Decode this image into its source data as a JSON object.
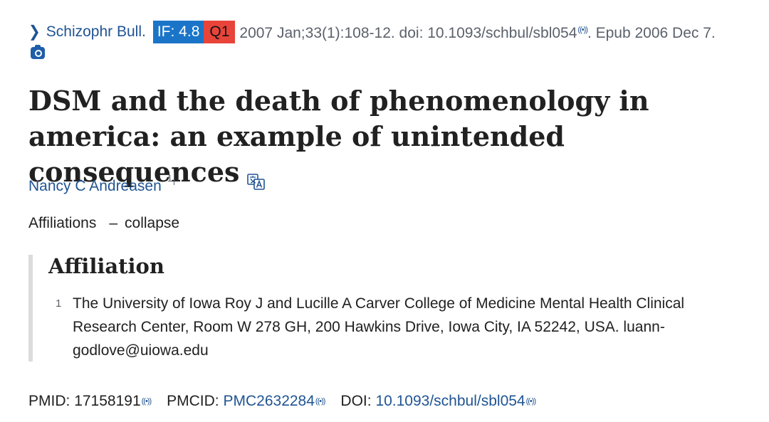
{
  "citation": {
    "journal": "Schizophr Bull.",
    "impact_factor": "IF: 4.8",
    "quartile": "Q1",
    "details": "2007 Jan;33(1):108-12. doi: 10.1093/schbul/sbl054",
    "epub": ". Epub 2006 Dec 7.",
    "colors": {
      "if_badge": "#1a75c9",
      "q_badge": "#e8443a",
      "link": "#205493"
    }
  },
  "icons": {
    "chevron": "chevron-right-icon",
    "camera": "camera-icon",
    "translate": "translate-icon",
    "signal": "signal-wave-icon"
  },
  "wave_glyph": "((•))",
  "article": {
    "title": "DSM and the death of phenomenology in america: an example of unintended consequences"
  },
  "authors": [
    {
      "name": "Nancy C Andreasen",
      "affiliation_ref": "1"
    }
  ],
  "affiliations_toggle": {
    "label": "Affiliations",
    "dash": "–",
    "action": "collapse"
  },
  "affiliation_box": {
    "heading": "Affiliation",
    "items": [
      {
        "number": "1",
        "text": "The University of Iowa Roy J and Lucille A Carver College of Medicine Mental Health Clinical Research Center, Room W 278 GH, 200 Hawkins Drive, Iowa City, IA 52242, USA. luann-godlove@uiowa.edu"
      }
    ]
  },
  "identifiers": {
    "pmid_label": "PMID:",
    "pmid_value": "17158191",
    "pmcid_label": "PMCID:",
    "pmcid_value": "PMC2632284",
    "doi_label": "DOI:",
    "doi_value": "10.1093/schbul/sbl054"
  }
}
